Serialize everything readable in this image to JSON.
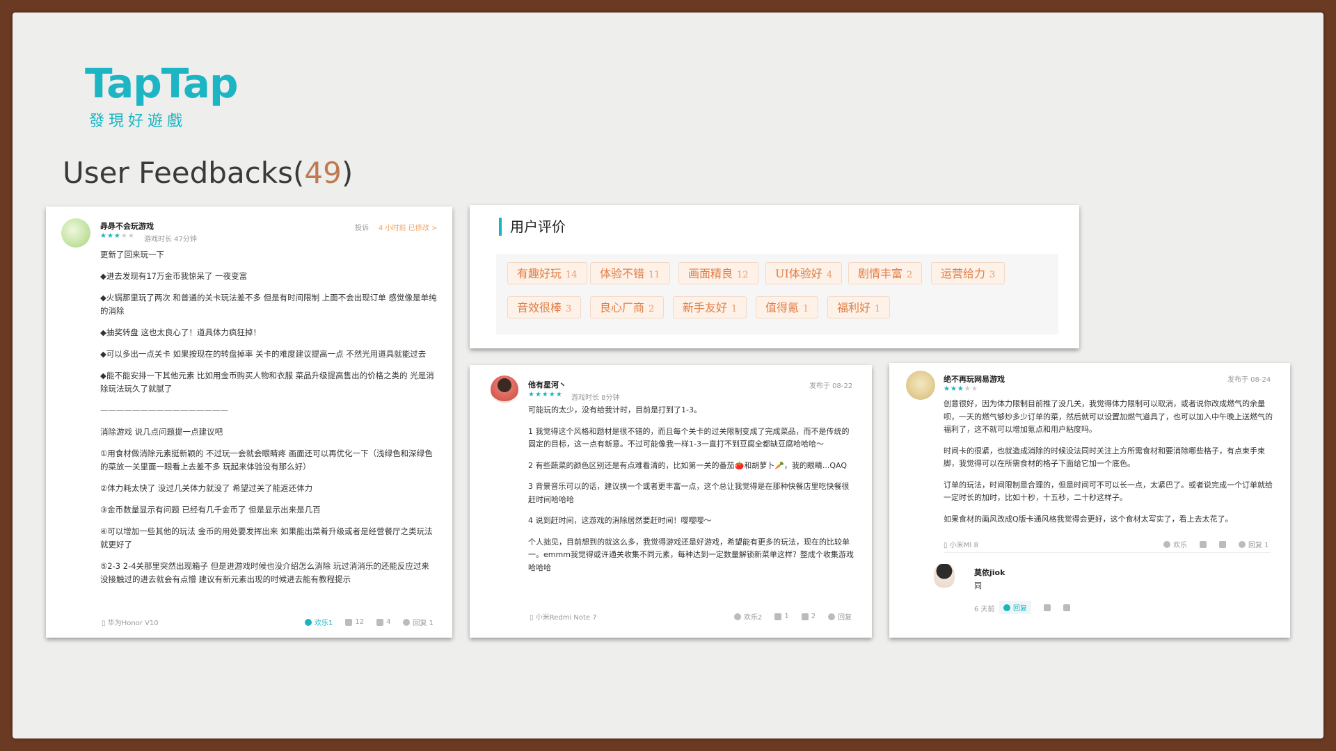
{
  "logo": {
    "main": "TapTap",
    "sub": "發現好遊戲"
  },
  "title": {
    "text": "User Feedbacks(",
    "count": "49",
    "close": ")"
  },
  "colors": {
    "accent": "#1bb5c4",
    "tag_text": "#e27d44",
    "tag_bg": "#fdf1e8"
  },
  "review1": {
    "user": "冔冔不会玩游戏",
    "rating": 3,
    "playtime": "游戏时长 47分钟",
    "report": "投诉",
    "time": "4 小时前 已修改 >",
    "paragraphs": [
      "更新了回来玩一下",
      "◆进去发现有17万金币我惊呆了 一夜变富",
      "◆火锅那里玩了两次 和普通的关卡玩法差不多 但是有时间限制 上面不会出现订单 感觉像是单纯的消除",
      "◆抽奖转盘 这也太良心了！道具体力疯狂掉！",
      "◆可以多出一点关卡 如果按现在的转盘掉率 关卡的难度建议提高一点 不然光用道具就能过去",
      "◆能不能安排一下其他元素 比如用金币购买人物和衣服 菜品升级提高售出的价格之类的 光是消除玩法玩久了就腻了",
      "————————————————",
      "消除游戏 说几点问题提一点建议吧",
      "①用食材做消除元素挺新颖的 不过玩一会就会眼睛疼 画面还可以再优化一下（浅绿色和深绿色的菜放一关里面一眼看上去差不多 玩起来体验没有那么好）",
      "②体力耗太快了 没过几关体力就没了 希望过关了能返还体力",
      "③金币数量显示有问题 已经有几千金币了 但是显示出来是几百",
      "④可以增加一些其他的玩法 金币的用处要发挥出来 如果能出菜肴升级或者是经营餐厅之类玩法就更好了",
      "⑤2-3 2-4关那里突然出现箱子 但是进游戏时候也没介绍怎么消除 玩过消消乐的还能反应过来 没接触过的进去就会有点懵 建议有新元素出现的时候进去能有教程提示"
    ],
    "device": "华为Honor V10",
    "fun": "欢乐1",
    "likes": "12",
    "dislikes": "4",
    "replies": "回复 1"
  },
  "tags": {
    "title": "用户评价",
    "items": [
      {
        "label": "有趣好玩",
        "count": "14"
      },
      {
        "label": "体验不错",
        "count": "11"
      },
      {
        "label": "画面精良",
        "count": "12"
      },
      {
        "label": "UI体验好",
        "count": "4"
      },
      {
        "label": "剧情丰富",
        "count": "2"
      },
      {
        "label": "运营给力",
        "count": "3"
      },
      {
        "label": "音效很棒",
        "count": "3"
      },
      {
        "label": "良心厂商",
        "count": "2"
      },
      {
        "label": "新手友好",
        "count": "1"
      },
      {
        "label": "值得氪",
        "count": "1"
      },
      {
        "label": "福利好",
        "count": "1"
      }
    ]
  },
  "review2": {
    "user": "他有星河丶",
    "rating": 5,
    "playtime": "游戏时长 8分钟",
    "time": "发布于 08-22",
    "paragraphs": [
      "可能玩的太少，没有给我计时，目前是打到了1-3。",
      "1 我觉得这个风格和题材是很不错的，而且每个关卡的过关限制变成了完成菜品，而不是传统的固定的目标，这一点有新意。不过可能像我一样1-3一直打不到豆腐全都缺豆腐哈哈哈～",
      "2 有些蔬菜的颜色区别还是有点难看清的，比如第一关的番茄🍅和胡萝卜🥕，我的眼睛...QAQ",
      "3 背景音乐可以的话，建议换一个或者更丰富一点，这个总让我觉得是在那种快餐店里吃快餐很赶时间哈哈哈",
      "4 说到赶时间，这游戏的消除居然要赶时间！嘤嘤嘤～",
      "个人拙见，目前想到的就这么多，我觉得游戏还是好游戏，希望能有更多的玩法，现在的比较单一。emmm我觉得或许通关收集不同元素，每种达到一定数量解锁新菜单这样？整成个收集游戏哈哈哈"
    ],
    "device": "小米Redmi Note 7",
    "fun": "欢乐2",
    "likes": "1",
    "dislikes": "2",
    "replies": "回复"
  },
  "review3": {
    "user": "绝不再玩网易游戏",
    "rating": 3,
    "time": "发布于 08-24",
    "paragraphs": [
      "创意很好，因为体力限制目前推了没几关，我觉得体力限制可以取消，或者说你改成燃气的余量呗，一天的燃气够炒多少订单的菜，然后就可以设置加燃气道具了，也可以加入中午晚上送燃气的福利了，这不就可以增加氪点和用户粘度吗。",
      "时间卡的很紧，也就造成消除的时候没法同时关注上方所需食材和要消除哪些格子，有点束手束脚，我觉得可以在所需食材的格子下面给它加一个底色。",
      "订单的玩法，时间限制是合理的，但是时间可不可以长一点，太紧巴了。或者说完成一个订单就给一定时长的加时，比如十秒，十五秒，二十秒这样子。",
      "如果食材的画风改成Q版卡通风格我觉得会更好，这个食材太写实了，看上去太花了。"
    ],
    "device": "小米MI 8",
    "fun": "欢乐",
    "replies": "回复 1",
    "reply": {
      "user": "莫依jiok",
      "text": "同",
      "time": "6 天前",
      "reply_label": "回复"
    }
  }
}
